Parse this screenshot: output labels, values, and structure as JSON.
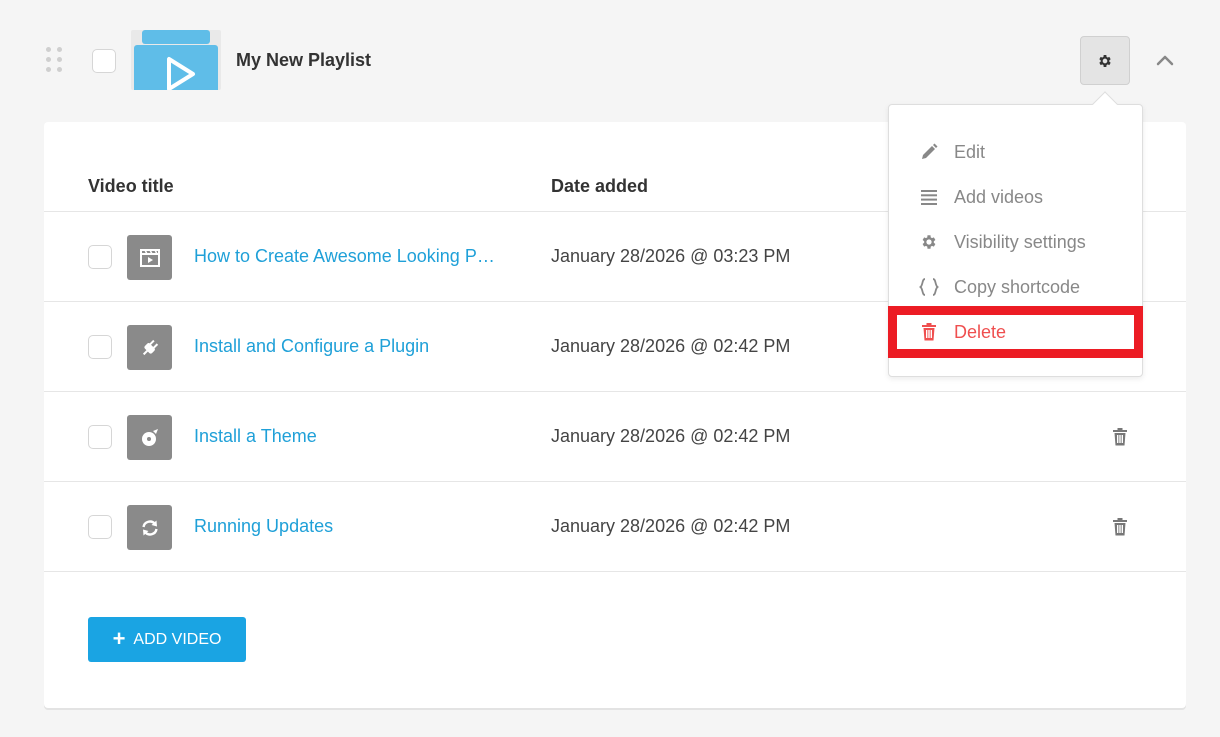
{
  "playlist": {
    "title": "My New Playlist"
  },
  "table": {
    "headers": {
      "title": "Video title",
      "date": "Date added"
    },
    "rows": [
      {
        "title": "How to Create Awesome Looking P…",
        "date": "January 28/2026 @ 03:23 PM",
        "icon": "clapperboard-icon"
      },
      {
        "title": "Install and Configure a Plugin",
        "date": "January 28/2026 @ 02:42 PM",
        "icon": "plug-icon"
      },
      {
        "title": "Install a Theme",
        "date": "January 28/2026 @ 02:42 PM",
        "icon": "paint-brush-icon"
      },
      {
        "title": "Running Updates",
        "date": "January 28/2026 @ 02:42 PM",
        "icon": "refresh-icon"
      }
    ]
  },
  "add_video_label": "ADD VIDEO",
  "menu": {
    "items": [
      {
        "label": "Edit",
        "icon": "pencil-icon"
      },
      {
        "label": "Add videos",
        "icon": "list-icon"
      },
      {
        "label": "Visibility settings",
        "icon": "gear-icon"
      },
      {
        "label": "Copy shortcode",
        "icon": "braces-icon"
      },
      {
        "label": "Delete",
        "icon": "trash-icon"
      }
    ]
  },
  "colors": {
    "accent": "#1aa4e3",
    "link": "#1fa0d8",
    "danger": "#ef4f4f",
    "highlight": "#ec1c24"
  }
}
